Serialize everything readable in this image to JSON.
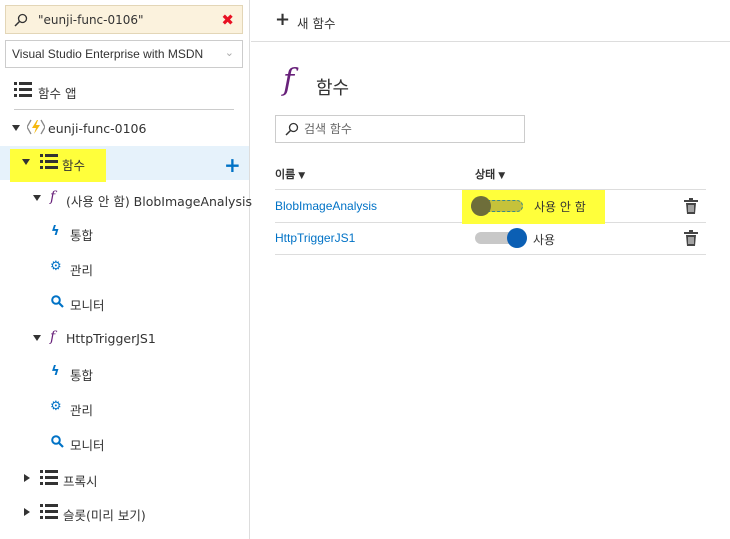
{
  "left_pane": {
    "search": {
      "value": "\"eunji-func-0106\"",
      "clear_icon": "close-icon"
    },
    "subscription": {
      "selected": "Visual Studio Enterprise with MSDN"
    },
    "tree": {
      "function_apps_label": "함수 앱",
      "app_label": "eunji-func-0106",
      "functions_label": "함수",
      "functions": [
        {
          "label": "(사용 안 함) BlobImageAnalysis",
          "children": [
            "통합",
            "관리",
            "모니터"
          ]
        },
        {
          "label": "HttpTriggerJS1",
          "children": [
            "통합",
            "관리",
            "모니터"
          ]
        }
      ],
      "proxies_label": "프록시",
      "slots_label": "슬롯(미리 보기)"
    },
    "highlight_color": "#ffff3b"
  },
  "toolbar": {
    "new_function_label": "새 함수"
  },
  "main": {
    "title": "함수",
    "search_placeholder": "검색 함수",
    "columns": {
      "name": "이름",
      "status": "상태"
    },
    "rows": [
      {
        "name": "BlobImageAnalysis",
        "status": "사용 안 함",
        "enabled": false
      },
      {
        "name": "HttpTriggerJS1",
        "status": "사용",
        "enabled": true
      }
    ]
  },
  "colors": {
    "accent": "#0072c6",
    "function_icon": "#68217a",
    "highlight": "#ffff3b",
    "toggle_on": "#0b5fb4"
  }
}
